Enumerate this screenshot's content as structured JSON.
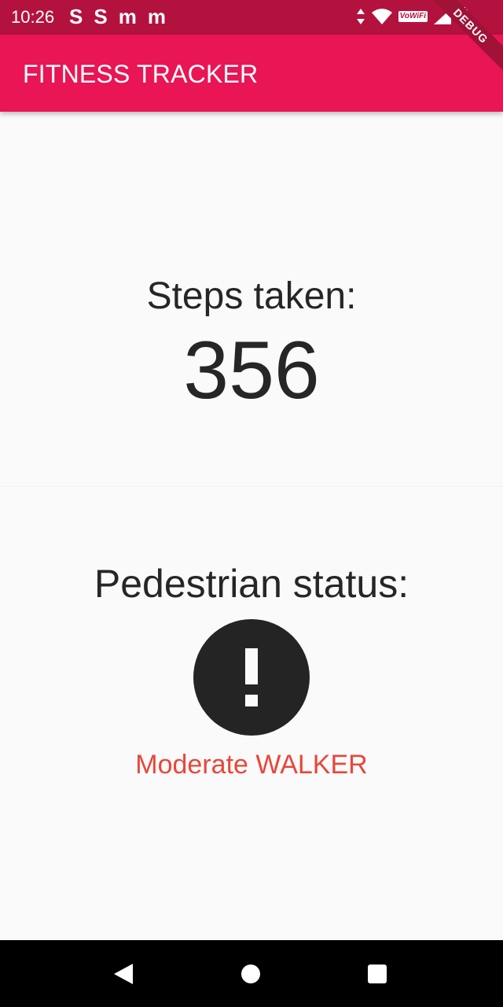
{
  "status_bar": {
    "time": "10:26",
    "notifications": [
      "S",
      "S",
      "m",
      "m"
    ],
    "vowifi": "VoWiFi",
    "icons": [
      "data-arrows-icon",
      "wifi-icon",
      "vowifi-icon",
      "signal-icon",
      "battery-icon"
    ]
  },
  "app_bar": {
    "title": "FITNESS TRACKER"
  },
  "debug_banner": {
    "label": "DEBUG"
  },
  "steps": {
    "label": "Steps taken:",
    "value": "356"
  },
  "pedestrian": {
    "label": "Pedestrian status:",
    "icon": "error-exclamation-icon",
    "status": "Moderate WALKER"
  },
  "nav_bar": {
    "buttons": [
      "back-icon",
      "home-icon",
      "recents-icon"
    ]
  },
  "colors": {
    "status_bar": "#b3123f",
    "app_bar": "#e91555",
    "background": "#fafafa",
    "status_text": "#e8473a"
  }
}
